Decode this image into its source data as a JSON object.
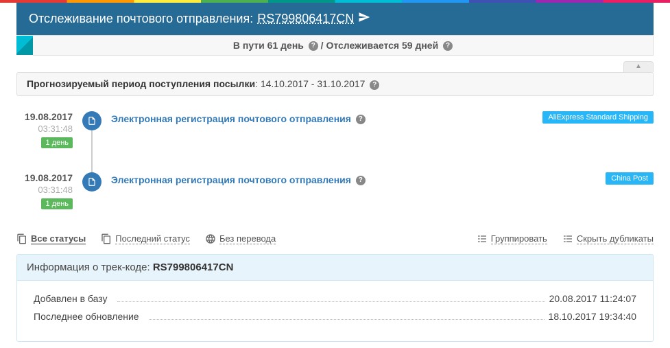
{
  "header": {
    "prefix": "Отслеживание почтового отправления:",
    "track": "RS799806417CN"
  },
  "status": {
    "transit_label": "В пути",
    "transit_days": "61",
    "transit_unit": "день",
    "sep": "/",
    "follow_label": "Отслеживается",
    "follow_days": "59",
    "follow_unit": "дней"
  },
  "forecast": {
    "label": "Прогнозируемый период поступления посылки",
    "range": "14.10.2017 - 31.10.2017"
  },
  "events": [
    {
      "date": "19.08.2017",
      "time": "03:31:48",
      "duration": "1 день",
      "title": "Электронная регистрация почтового отправления",
      "carrier": "AliExpress Standard Shipping",
      "carrier_class": "c-ae"
    },
    {
      "date": "19.08.2017",
      "time": "03:31:48",
      "duration": "1 день",
      "title": "Электронная регистрация почтового отправления",
      "carrier": "China Post",
      "carrier_class": "c-cp"
    }
  ],
  "toolbar": {
    "all": "Все статусы",
    "last": "Последний статус",
    "notranslate": "Без перевода",
    "group": "Группировать",
    "hidedup": "Скрыть дубликаты"
  },
  "info": {
    "head_prefix": "Информация о трек-коде:",
    "head_code": "RS799806417CN",
    "rows": [
      {
        "label": "Добавлен в базу",
        "value": "20.08.2017 11:24:07"
      },
      {
        "label": "Последнее обновление",
        "value": "18.10.2017 19:34:40"
      }
    ]
  }
}
